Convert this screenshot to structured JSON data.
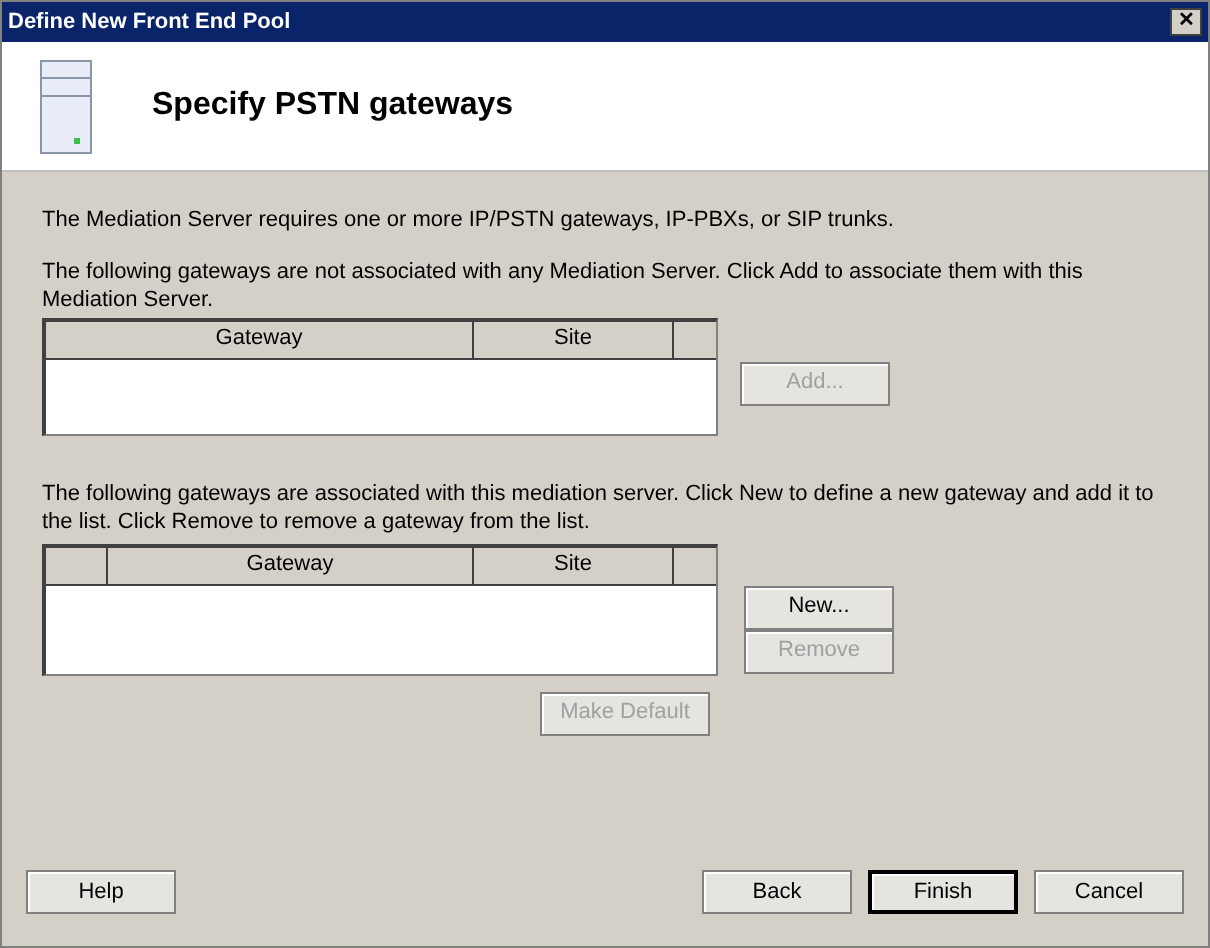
{
  "window": {
    "title": "Define New Front End Pool",
    "close": "✕"
  },
  "header": {
    "title": "Specify PSTN gateways"
  },
  "intro": "The Mediation Server requires one or more IP/PSTN gateways, IP-PBXs, or SIP trunks.",
  "unassociated": {
    "description": "The following gateways are not associated with any Mediation Server.  Click Add to associate them with this Mediation Server.",
    "columns": [
      "Gateway",
      "Site"
    ],
    "buttons": [
      {
        "label": "Add...",
        "disabled": true
      }
    ]
  },
  "associated": {
    "description": "The following gateways are associated with this mediation server.  Click New to define a new gateway and add it to the list.  Click Remove to remove a gateway from the list.",
    "columns": [
      "Gateway",
      "Site"
    ],
    "buttons": [
      {
        "label": "New...",
        "disabled": false
      },
      {
        "label": "Remove",
        "disabled": true
      }
    ],
    "make_default": {
      "label": "Make Default",
      "disabled": true
    }
  },
  "footer": {
    "help": {
      "label": "Help",
      "default": false
    },
    "buttons": [
      {
        "label": "Back",
        "default": false
      },
      {
        "label": "Finish",
        "default": true
      },
      {
        "label": "Cancel",
        "default": false
      }
    ]
  }
}
